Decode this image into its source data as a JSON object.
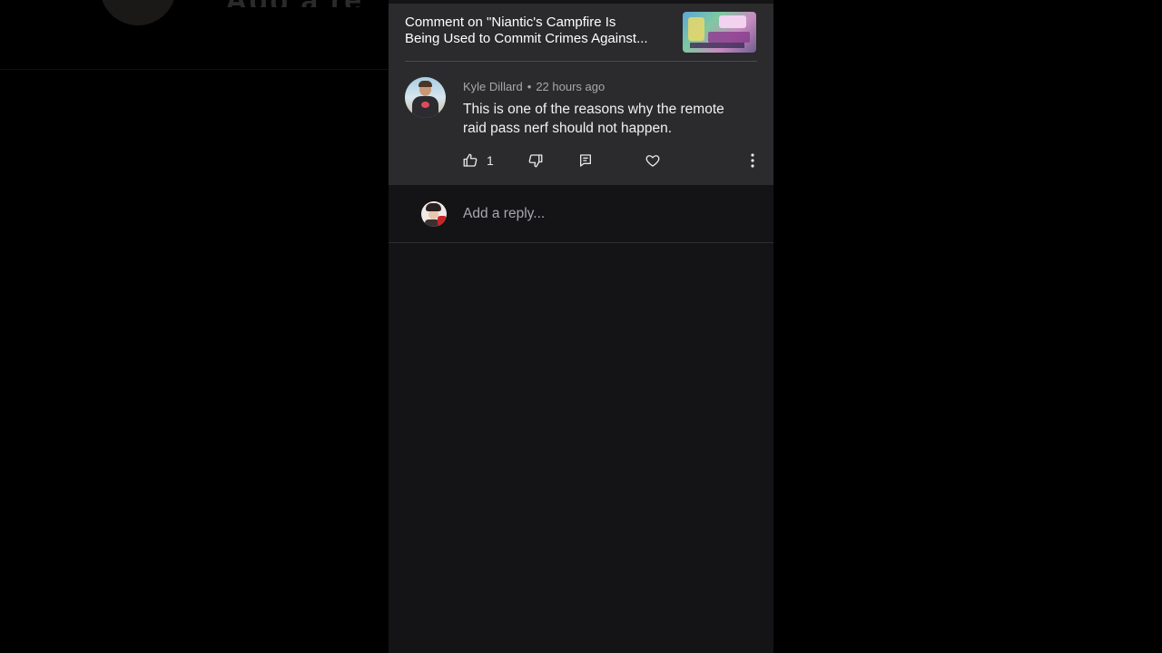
{
  "background": {
    "blurred_name": "Add a re"
  },
  "context": {
    "line1": "Comment on \"Niantic's Campfire Is",
    "line2": "Being Used to Commit Crimes Against..."
  },
  "comment": {
    "author": "Kyle Dillard",
    "separator": "•",
    "time": "22 hours ago",
    "text_line1": "This is one of the reasons why the remote",
    "text_line2": "raid pass nerf should not happen.",
    "like_count": "1"
  },
  "icons": {
    "like": "thumbs-up-icon",
    "dislike": "thumbs-down-icon",
    "reply": "comment-icon",
    "heart": "heart-icon",
    "more": "more-vertical-icon"
  },
  "reply_box": {
    "placeholder": "Add a reply..."
  },
  "colors": {
    "page_background": "#000000",
    "panel_background": "#141316",
    "card_background": "#2b2a2c",
    "text_primary": "#f1f0f2",
    "text_secondary": "#a8a6aa"
  }
}
